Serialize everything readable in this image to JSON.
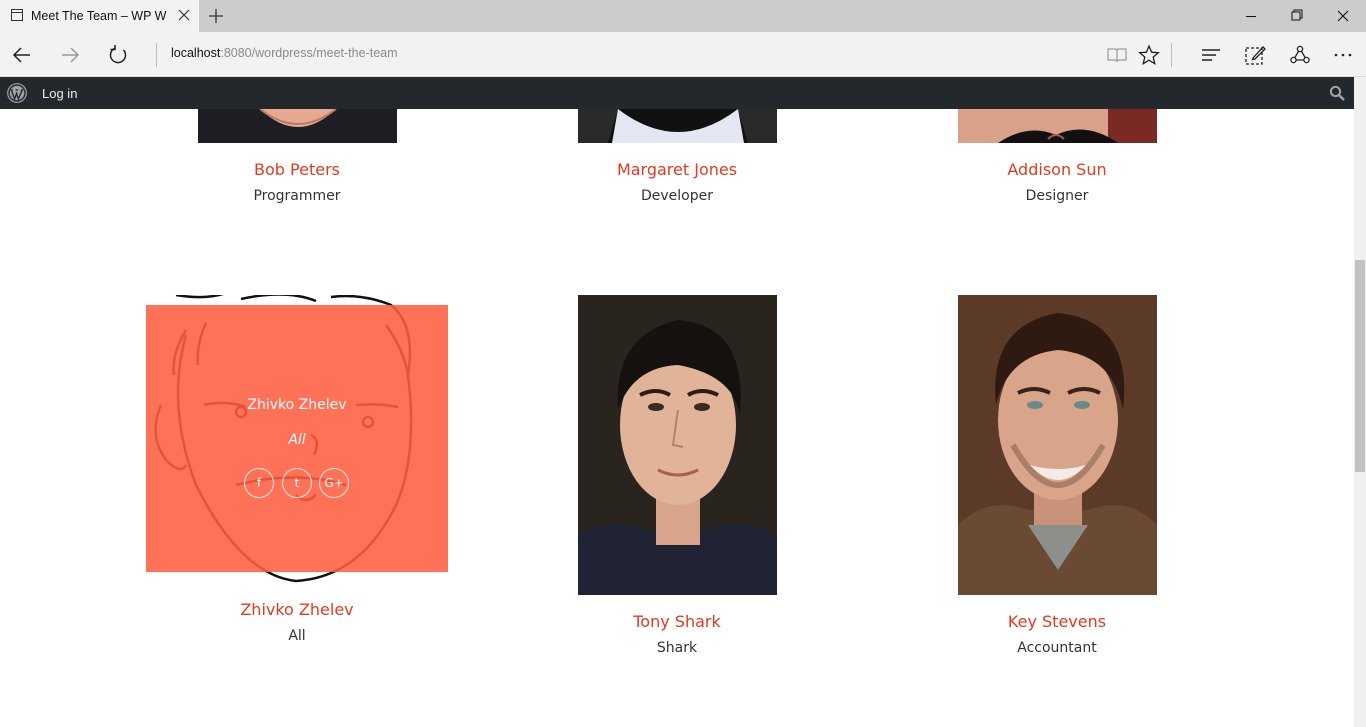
{
  "browser": {
    "tab_title": "Meet The Team – WP W",
    "address_host": "localhost",
    "address_rest": ":8080/wordpress/meet-the-team"
  },
  "adminbar": {
    "login_label": "Log in"
  },
  "team_rows": [
    {
      "name": "Bob Peters",
      "role": "Programmer"
    },
    {
      "name": "Margaret Jones",
      "role": "Developer"
    },
    {
      "name": "Addison Sun",
      "role": "Designer"
    },
    {
      "name": "Zhivko Zhelev",
      "role": "All"
    },
    {
      "name": "Tony Shark",
      "role": "Shark"
    },
    {
      "name": "Key Stevens",
      "role": "Accountant"
    }
  ],
  "hover_card": {
    "name": "Zhivko Zhelev",
    "role": "All",
    "social": [
      {
        "icon": "facebook-icon",
        "glyph": "f"
      },
      {
        "icon": "twitter-icon",
        "glyph": "t"
      },
      {
        "icon": "google-plus-icon",
        "glyph": "G+"
      }
    ]
  },
  "colors": {
    "accent": "#e8381c",
    "overlay": "#ff5f40",
    "adminbar": "#23282d"
  }
}
